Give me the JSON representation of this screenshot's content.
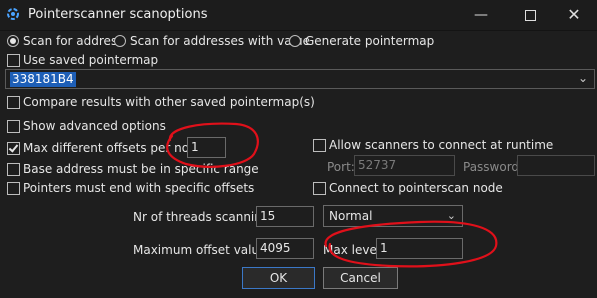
{
  "window": {
    "title": "Pointerscanner scanoptions",
    "minimize_glyph": "—",
    "close_glyph": "✕"
  },
  "scan_mode": {
    "options": [
      {
        "label": "Scan for address",
        "selected": true
      },
      {
        "label": "Scan for addresses with value",
        "selected": false
      },
      {
        "label": "Generate pointermap",
        "selected": false
      }
    ]
  },
  "use_saved_pointermap": {
    "label": "Use saved pointermap",
    "checked": false
  },
  "address_combo": {
    "value": "338181B4",
    "arrow": "⌄"
  },
  "compare_results": {
    "label": "Compare results with other saved pointermap(s)",
    "checked": false
  },
  "left_options": {
    "show_advanced": {
      "label": "Show advanced options",
      "checked": false
    },
    "max_offsets": {
      "label": "Max different offsets per node:",
      "checked": true,
      "value": "1"
    },
    "base_address_range": {
      "label": "Base address must be in specific range",
      "checked": false
    },
    "pointers_end_offsets": {
      "label": "Pointers must end with specific offsets",
      "checked": false
    }
  },
  "right_options": {
    "allow_scanners": {
      "label": "Allow scanners to connect at runtime",
      "checked": false
    },
    "port_label": "Port:",
    "port_value": "52737",
    "password_label": "Password",
    "connect_node": {
      "label": "Connect to pointerscan node",
      "checked": false
    }
  },
  "threads": {
    "label": "Nr of threads scanning:",
    "value": "15",
    "priority": "Normal",
    "arrow": "⌄"
  },
  "max_offset": {
    "label": "Maximum offset value:",
    "value": "4095"
  },
  "max_level": {
    "label": "Max level",
    "value": "1"
  },
  "buttons": {
    "ok": "OK",
    "cancel": "Cancel"
  },
  "colors": {
    "selection": "#1e5fb7",
    "annotation": "#e0101a",
    "background": "#1e1e1e"
  }
}
